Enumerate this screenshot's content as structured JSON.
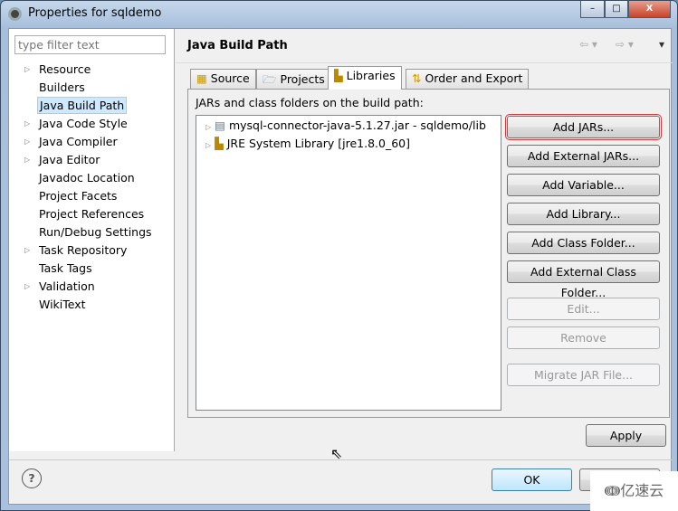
{
  "window": {
    "title": "Properties for sqldemo",
    "minimize": "–",
    "maximize": "□",
    "close": "X"
  },
  "sidebar": {
    "filter_placeholder": "type filter text",
    "items": [
      {
        "label": "Resource",
        "expandable": true
      },
      {
        "label": "Builders",
        "expandable": false
      },
      {
        "label": "Java Build Path",
        "expandable": false,
        "selected": true
      },
      {
        "label": "Java Code Style",
        "expandable": true
      },
      {
        "label": "Java Compiler",
        "expandable": true
      },
      {
        "label": "Java Editor",
        "expandable": true
      },
      {
        "label": "Javadoc Location",
        "expandable": false
      },
      {
        "label": "Project Facets",
        "expandable": false
      },
      {
        "label": "Project References",
        "expandable": false
      },
      {
        "label": "Run/Debug Settings",
        "expandable": false
      },
      {
        "label": "Task Repository",
        "expandable": true
      },
      {
        "label": "Task Tags",
        "expandable": false
      },
      {
        "label": "Validation",
        "expandable": true
      },
      {
        "label": "WikiText",
        "expandable": false
      }
    ]
  },
  "header": {
    "title": "Java Build Path"
  },
  "tabs": [
    {
      "label": "Source"
    },
    {
      "label": "Projects"
    },
    {
      "label": "Libraries",
      "active": true
    },
    {
      "label": "Order and Export"
    }
  ],
  "libraries": {
    "label": "JARs and class folders on the build path:",
    "entries": [
      "mysql-connector-java-5.1.27.jar - sqldemo/lib",
      "JRE System Library [jre1.8.0_60]"
    ]
  },
  "buttons": {
    "add_jars": "Add JARs...",
    "add_external_jars": "Add External JARs...",
    "add_variable": "Add Variable...",
    "add_library": "Add Library...",
    "add_class_folder": "Add Class Folder...",
    "add_external_class_folder": "Add External Class Folder...",
    "edit": "Edit...",
    "remove": "Remove",
    "migrate": "Migrate JAR File...",
    "apply": "Apply",
    "ok": "OK",
    "help": "?"
  },
  "watermark": "亿速云"
}
